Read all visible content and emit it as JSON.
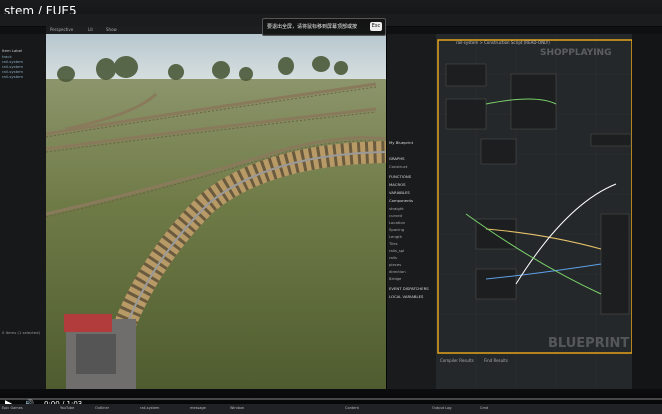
{
  "window": {
    "title": "stem / FUE5"
  },
  "overlay": {
    "message": "要退出全屏，请将鼠标移到屏幕顶部或按",
    "esc_label": "Esc"
  },
  "viewport": {
    "perspective": "Perspective",
    "lit": "Lit",
    "show": "Show"
  },
  "graph": {
    "title": "rail-system > Construction Script (READ-ONLY)",
    "watermark": "BLUEPRINT",
    "badge": "SHOPPLAYING",
    "bottom": [
      "Compiler Results",
      "Find Results"
    ]
  },
  "details": {
    "header": "My Blueprint",
    "sections": [
      "GRAPHS",
      "FUNCTIONS",
      "MACROS",
      "VARIABLES",
      "Components",
      "EVENT DISPATCHERS",
      "LOCAL VARIABLES"
    ],
    "items": [
      "Construct",
      "straight",
      "curved",
      "Location",
      "Spacing",
      "Length",
      "Tiles",
      "rails_spl",
      "rails",
      "pieces",
      "direction",
      "Bridge"
    ]
  },
  "outliner": {
    "rows": [
      "Item Label",
      "track",
      "rail-system",
      "rail-system",
      "rail-system",
      "rail-system"
    ],
    "footer": "0 items (1 selected)"
  },
  "player": {
    "time": "0:00 / 1:03",
    "progress": 0.0
  },
  "taskbar": [
    "Epic Games",
    "YouTube",
    "Outliner",
    "rail-system",
    "message",
    "Window",
    "Content",
    "Output Log",
    "Cmd"
  ]
}
